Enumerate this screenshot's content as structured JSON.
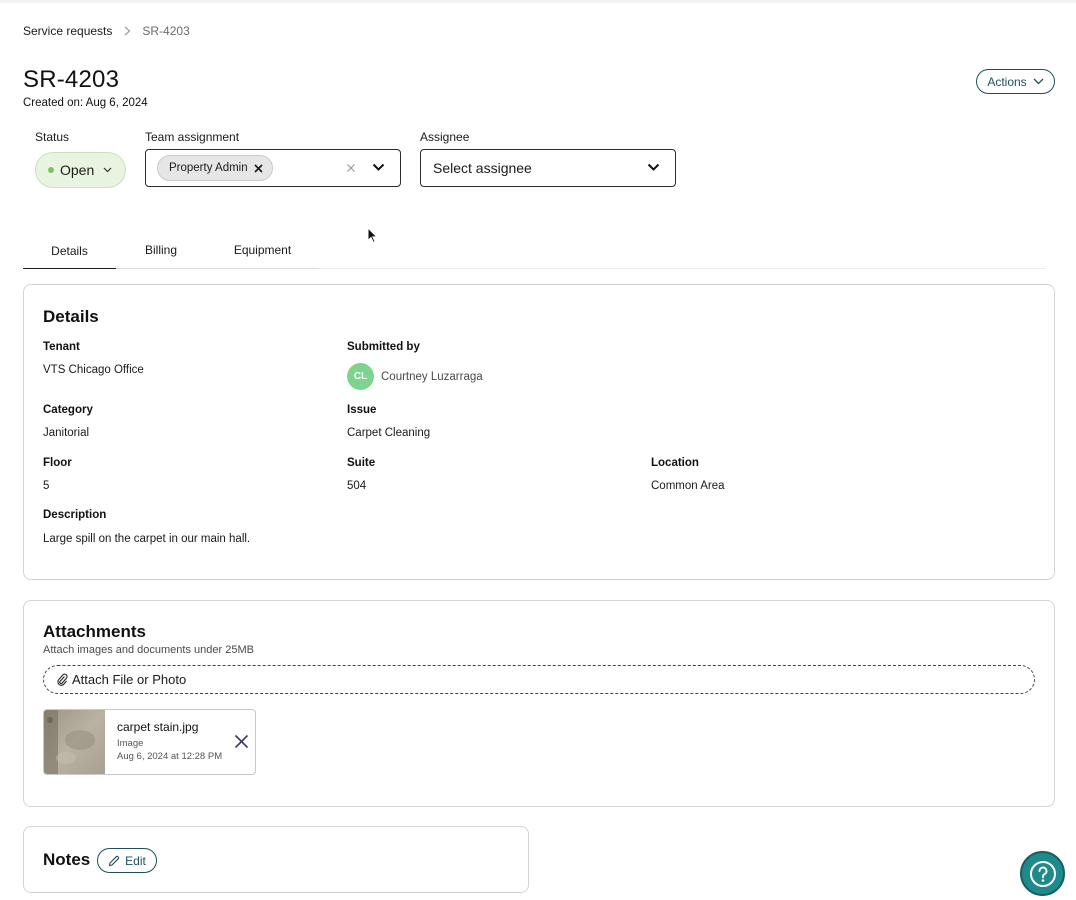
{
  "breadcrumb": {
    "parent": "Service requests",
    "current": "SR-4203"
  },
  "header": {
    "title": "SR-4203",
    "created_on": "Created on: Aug 6, 2024",
    "actions_label": "Actions"
  },
  "fields": {
    "status_label": "Status",
    "status_value": "Open",
    "team_label": "Team assignment",
    "team_chip": "Property Admin",
    "assignee_label": "Assignee",
    "assignee_placeholder": "Select assignee"
  },
  "tabs": [
    {
      "label": "Details",
      "active": true
    },
    {
      "label": "Billing",
      "active": false
    },
    {
      "label": "Equipment",
      "active": false
    }
  ],
  "details": {
    "title": "Details",
    "tenant_label": "Tenant",
    "tenant_value": "VTS Chicago Office",
    "submitted_by_label": "Submitted by",
    "submitter_initials": "CL",
    "submitter_name": "Courtney Luzarraga",
    "category_label": "Category",
    "category_value": "Janitorial",
    "issue_label": "Issue",
    "issue_value": "Carpet Cleaning",
    "floor_label": "Floor",
    "floor_value": "5",
    "suite_label": "Suite",
    "suite_value": "504",
    "location_label": "Location",
    "location_value": "Common Area",
    "description_label": "Description",
    "description_value": "Large spill on the carpet in our main hall."
  },
  "attachments": {
    "title": "Attachments",
    "hint": "Attach images and documents under 25MB",
    "attach_button": "Attach File or Photo",
    "files": [
      {
        "name": "carpet stain.jpg",
        "type": "Image",
        "date": "Aug 6, 2024 at 12:28 PM"
      }
    ]
  },
  "notes": {
    "title": "Notes",
    "edit_label": "Edit"
  },
  "colors": {
    "accent": "#1f4f5c",
    "status_bg": "#e8f4e0",
    "status_dot": "#7bc16a",
    "avatar_bg": "#7dd48e",
    "help_bg": "#1f8a8c"
  },
  "icons": {
    "breadcrumb_separator": "chevron-right-icon",
    "actions": "chevron-down-icon",
    "chip_remove": "close-icon",
    "clear": "clear-icon",
    "dropdown": "chevron-down-icon",
    "attach": "paperclip-icon",
    "file_remove": "close-icon",
    "edit": "pencil-icon",
    "help": "help-icon"
  }
}
